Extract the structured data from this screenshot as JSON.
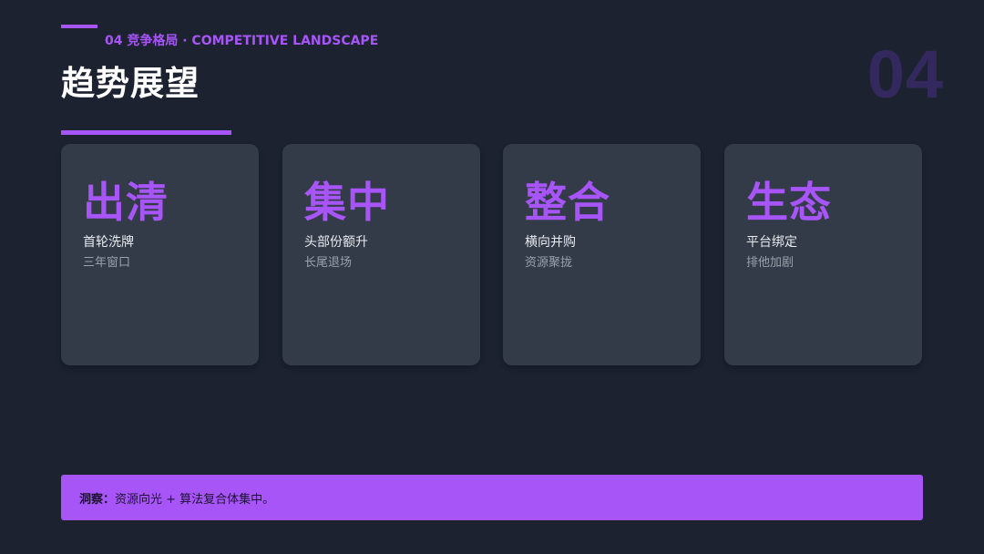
{
  "header": {
    "section_label": "04  竞争格局 · COMPETITIVE LANDSCAPE",
    "title": "趋势展望",
    "page_number": "04"
  },
  "cards": [
    {
      "heading": "出清",
      "line1": "首轮洗牌",
      "line2": "三年窗口"
    },
    {
      "heading": "集中",
      "line1": "头部份额升",
      "line2": "长尾退场"
    },
    {
      "heading": "整合",
      "line1": "横向并购",
      "line2": "资源聚拢"
    },
    {
      "heading": "生态",
      "line1": "平台绑定",
      "line2": "排他加剧"
    }
  ],
  "insight": {
    "label": "洞察：",
    "text": "资源向光 + 算法复合体集中。"
  },
  "colors": {
    "accent": "#a855f7",
    "background": "#1c2230",
    "card": "#333b48",
    "page_number": "#34295f"
  }
}
